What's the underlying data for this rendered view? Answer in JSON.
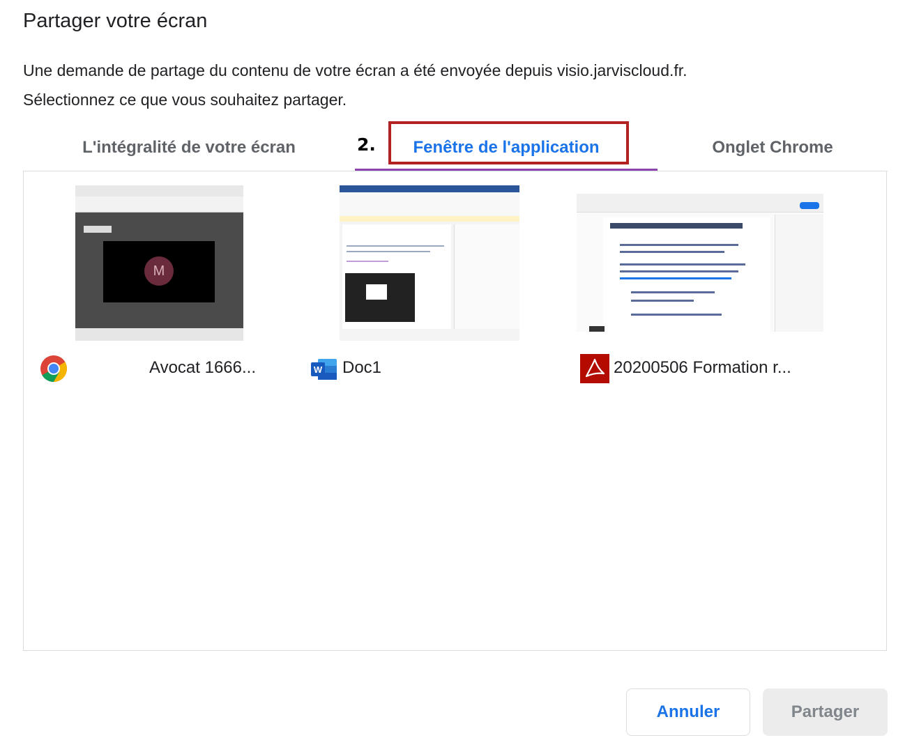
{
  "dialog": {
    "title": "Partager votre écran",
    "description_line1": "Une demande de partage du contenu de votre écran a été envoyée depuis visio.jarviscloud.fr.",
    "description_line2": "Sélectionnez ce que vous souhaitez partager."
  },
  "tabs": [
    {
      "label": "L'intégralité de votre écran",
      "selected": false
    },
    {
      "label": "Fenêtre de l'application",
      "selected": true
    },
    {
      "label": "Onglet Chrome",
      "selected": false
    }
  ],
  "annotation": {
    "step_label": "2."
  },
  "sources": [
    {
      "label": "Avocat 1666...",
      "icon": "chrome-icon",
      "thumb_avatar_letter": "M"
    },
    {
      "label": "Doc1",
      "icon": "word-icon",
      "icon_letter": "W"
    },
    {
      "label": "20200506 Formation r...",
      "icon": "acrobat-icon"
    }
  ],
  "buttons": {
    "cancel": "Annuler",
    "share": "Partager"
  },
  "colors": {
    "accent": "#1a73e8",
    "tab_underline": "#8e44ad",
    "annotation_box": "#b22222"
  }
}
